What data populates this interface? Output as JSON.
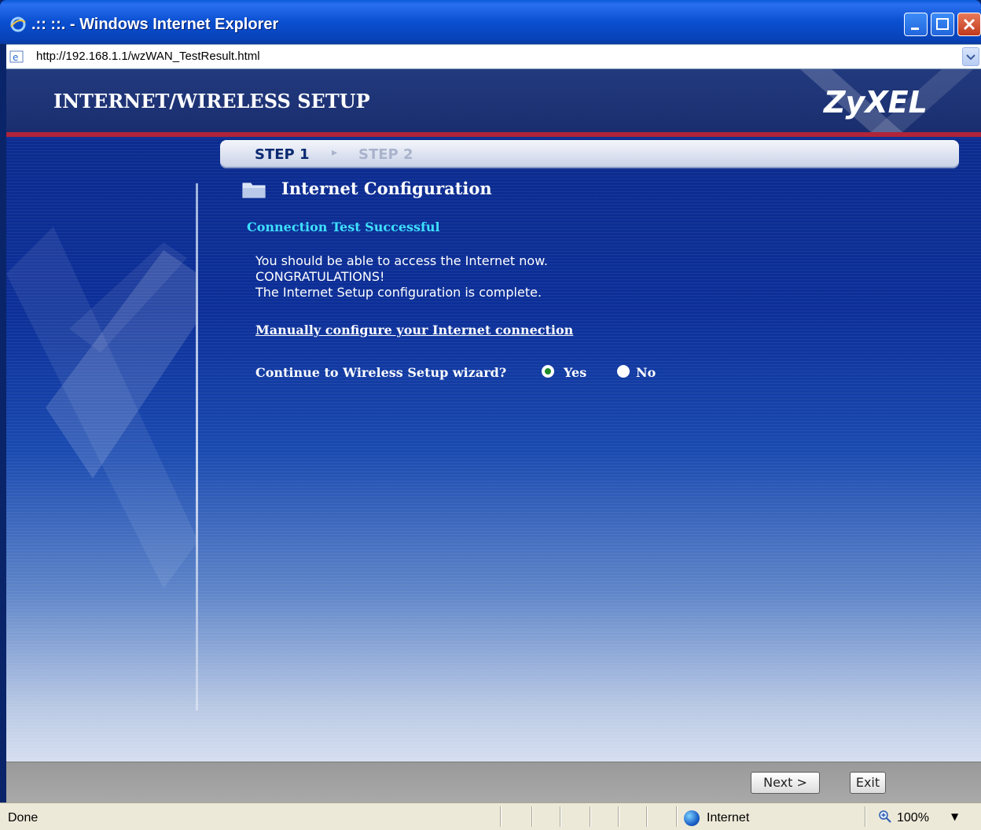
{
  "window": {
    "title": ".:: ::. - Windows Internet Explorer",
    "url": "http://192.168.1.1/wzWAN_TestResult.html"
  },
  "header": {
    "title": "INTERNET/WIRELESS SETUP",
    "logo": "ZyXEL"
  },
  "steps": {
    "step1": "STEP 1",
    "step2": "STEP 2",
    "separator": "▸"
  },
  "section": {
    "title": "Internet Configuration",
    "icon": "folder-icon"
  },
  "result": {
    "status": "Connection Test Successful",
    "lines": [
      "You should be able to access the Internet now.",
      "CONGRATULATIONS!",
      "The Internet Setup configuration is complete."
    ],
    "manual_link": "Manually configure your Internet connection"
  },
  "wizard": {
    "question": "Continue to Wireless Setup wizard?",
    "options": [
      "Yes",
      "No"
    ],
    "selected": "Yes"
  },
  "buttons": {
    "next": "Next >",
    "exit": "Exit"
  },
  "statusbar": {
    "status": "Done",
    "zone": "Internet",
    "zoom": "100%"
  },
  "colors": {
    "accent_cyan": "#3ee0ff",
    "header_stripe": "#b0243a",
    "page_blue": "#0c2f98"
  }
}
